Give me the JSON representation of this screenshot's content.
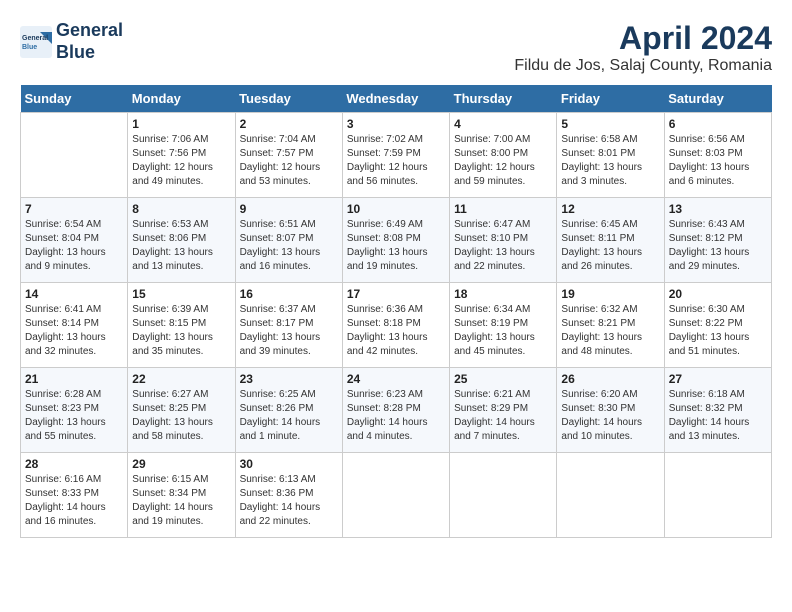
{
  "header": {
    "logo_line1": "General",
    "logo_line2": "Blue",
    "month_year": "April 2024",
    "location": "Fildu de Jos, Salaj County, Romania"
  },
  "weekdays": [
    "Sunday",
    "Monday",
    "Tuesday",
    "Wednesday",
    "Thursday",
    "Friday",
    "Saturday"
  ],
  "weeks": [
    [
      {
        "day": "",
        "sunrise": "",
        "sunset": "",
        "daylight": ""
      },
      {
        "day": "1",
        "sunrise": "Sunrise: 7:06 AM",
        "sunset": "Sunset: 7:56 PM",
        "daylight": "Daylight: 12 hours and 49 minutes."
      },
      {
        "day": "2",
        "sunrise": "Sunrise: 7:04 AM",
        "sunset": "Sunset: 7:57 PM",
        "daylight": "Daylight: 12 hours and 53 minutes."
      },
      {
        "day": "3",
        "sunrise": "Sunrise: 7:02 AM",
        "sunset": "Sunset: 7:59 PM",
        "daylight": "Daylight: 12 hours and 56 minutes."
      },
      {
        "day": "4",
        "sunrise": "Sunrise: 7:00 AM",
        "sunset": "Sunset: 8:00 PM",
        "daylight": "Daylight: 12 hours and 59 minutes."
      },
      {
        "day": "5",
        "sunrise": "Sunrise: 6:58 AM",
        "sunset": "Sunset: 8:01 PM",
        "daylight": "Daylight: 13 hours and 3 minutes."
      },
      {
        "day": "6",
        "sunrise": "Sunrise: 6:56 AM",
        "sunset": "Sunset: 8:03 PM",
        "daylight": "Daylight: 13 hours and 6 minutes."
      }
    ],
    [
      {
        "day": "7",
        "sunrise": "Sunrise: 6:54 AM",
        "sunset": "Sunset: 8:04 PM",
        "daylight": "Daylight: 13 hours and 9 minutes."
      },
      {
        "day": "8",
        "sunrise": "Sunrise: 6:53 AM",
        "sunset": "Sunset: 8:06 PM",
        "daylight": "Daylight: 13 hours and 13 minutes."
      },
      {
        "day": "9",
        "sunrise": "Sunrise: 6:51 AM",
        "sunset": "Sunset: 8:07 PM",
        "daylight": "Daylight: 13 hours and 16 minutes."
      },
      {
        "day": "10",
        "sunrise": "Sunrise: 6:49 AM",
        "sunset": "Sunset: 8:08 PM",
        "daylight": "Daylight: 13 hours and 19 minutes."
      },
      {
        "day": "11",
        "sunrise": "Sunrise: 6:47 AM",
        "sunset": "Sunset: 8:10 PM",
        "daylight": "Daylight: 13 hours and 22 minutes."
      },
      {
        "day": "12",
        "sunrise": "Sunrise: 6:45 AM",
        "sunset": "Sunset: 8:11 PM",
        "daylight": "Daylight: 13 hours and 26 minutes."
      },
      {
        "day": "13",
        "sunrise": "Sunrise: 6:43 AM",
        "sunset": "Sunset: 8:12 PM",
        "daylight": "Daylight: 13 hours and 29 minutes."
      }
    ],
    [
      {
        "day": "14",
        "sunrise": "Sunrise: 6:41 AM",
        "sunset": "Sunset: 8:14 PM",
        "daylight": "Daylight: 13 hours and 32 minutes."
      },
      {
        "day": "15",
        "sunrise": "Sunrise: 6:39 AM",
        "sunset": "Sunset: 8:15 PM",
        "daylight": "Daylight: 13 hours and 35 minutes."
      },
      {
        "day": "16",
        "sunrise": "Sunrise: 6:37 AM",
        "sunset": "Sunset: 8:17 PM",
        "daylight": "Daylight: 13 hours and 39 minutes."
      },
      {
        "day": "17",
        "sunrise": "Sunrise: 6:36 AM",
        "sunset": "Sunset: 8:18 PM",
        "daylight": "Daylight: 13 hours and 42 minutes."
      },
      {
        "day": "18",
        "sunrise": "Sunrise: 6:34 AM",
        "sunset": "Sunset: 8:19 PM",
        "daylight": "Daylight: 13 hours and 45 minutes."
      },
      {
        "day": "19",
        "sunrise": "Sunrise: 6:32 AM",
        "sunset": "Sunset: 8:21 PM",
        "daylight": "Daylight: 13 hours and 48 minutes."
      },
      {
        "day": "20",
        "sunrise": "Sunrise: 6:30 AM",
        "sunset": "Sunset: 8:22 PM",
        "daylight": "Daylight: 13 hours and 51 minutes."
      }
    ],
    [
      {
        "day": "21",
        "sunrise": "Sunrise: 6:28 AM",
        "sunset": "Sunset: 8:23 PM",
        "daylight": "Daylight: 13 hours and 55 minutes."
      },
      {
        "day": "22",
        "sunrise": "Sunrise: 6:27 AM",
        "sunset": "Sunset: 8:25 PM",
        "daylight": "Daylight: 13 hours and 58 minutes."
      },
      {
        "day": "23",
        "sunrise": "Sunrise: 6:25 AM",
        "sunset": "Sunset: 8:26 PM",
        "daylight": "Daylight: 14 hours and 1 minute."
      },
      {
        "day": "24",
        "sunrise": "Sunrise: 6:23 AM",
        "sunset": "Sunset: 8:28 PM",
        "daylight": "Daylight: 14 hours and 4 minutes."
      },
      {
        "day": "25",
        "sunrise": "Sunrise: 6:21 AM",
        "sunset": "Sunset: 8:29 PM",
        "daylight": "Daylight: 14 hours and 7 minutes."
      },
      {
        "day": "26",
        "sunrise": "Sunrise: 6:20 AM",
        "sunset": "Sunset: 8:30 PM",
        "daylight": "Daylight: 14 hours and 10 minutes."
      },
      {
        "day": "27",
        "sunrise": "Sunrise: 6:18 AM",
        "sunset": "Sunset: 8:32 PM",
        "daylight": "Daylight: 14 hours and 13 minutes."
      }
    ],
    [
      {
        "day": "28",
        "sunrise": "Sunrise: 6:16 AM",
        "sunset": "Sunset: 8:33 PM",
        "daylight": "Daylight: 14 hours and 16 minutes."
      },
      {
        "day": "29",
        "sunrise": "Sunrise: 6:15 AM",
        "sunset": "Sunset: 8:34 PM",
        "daylight": "Daylight: 14 hours and 19 minutes."
      },
      {
        "day": "30",
        "sunrise": "Sunrise: 6:13 AM",
        "sunset": "Sunset: 8:36 PM",
        "daylight": "Daylight: 14 hours and 22 minutes."
      },
      {
        "day": "",
        "sunrise": "",
        "sunset": "",
        "daylight": ""
      },
      {
        "day": "",
        "sunrise": "",
        "sunset": "",
        "daylight": ""
      },
      {
        "day": "",
        "sunrise": "",
        "sunset": "",
        "daylight": ""
      },
      {
        "day": "",
        "sunrise": "",
        "sunset": "",
        "daylight": ""
      }
    ]
  ]
}
